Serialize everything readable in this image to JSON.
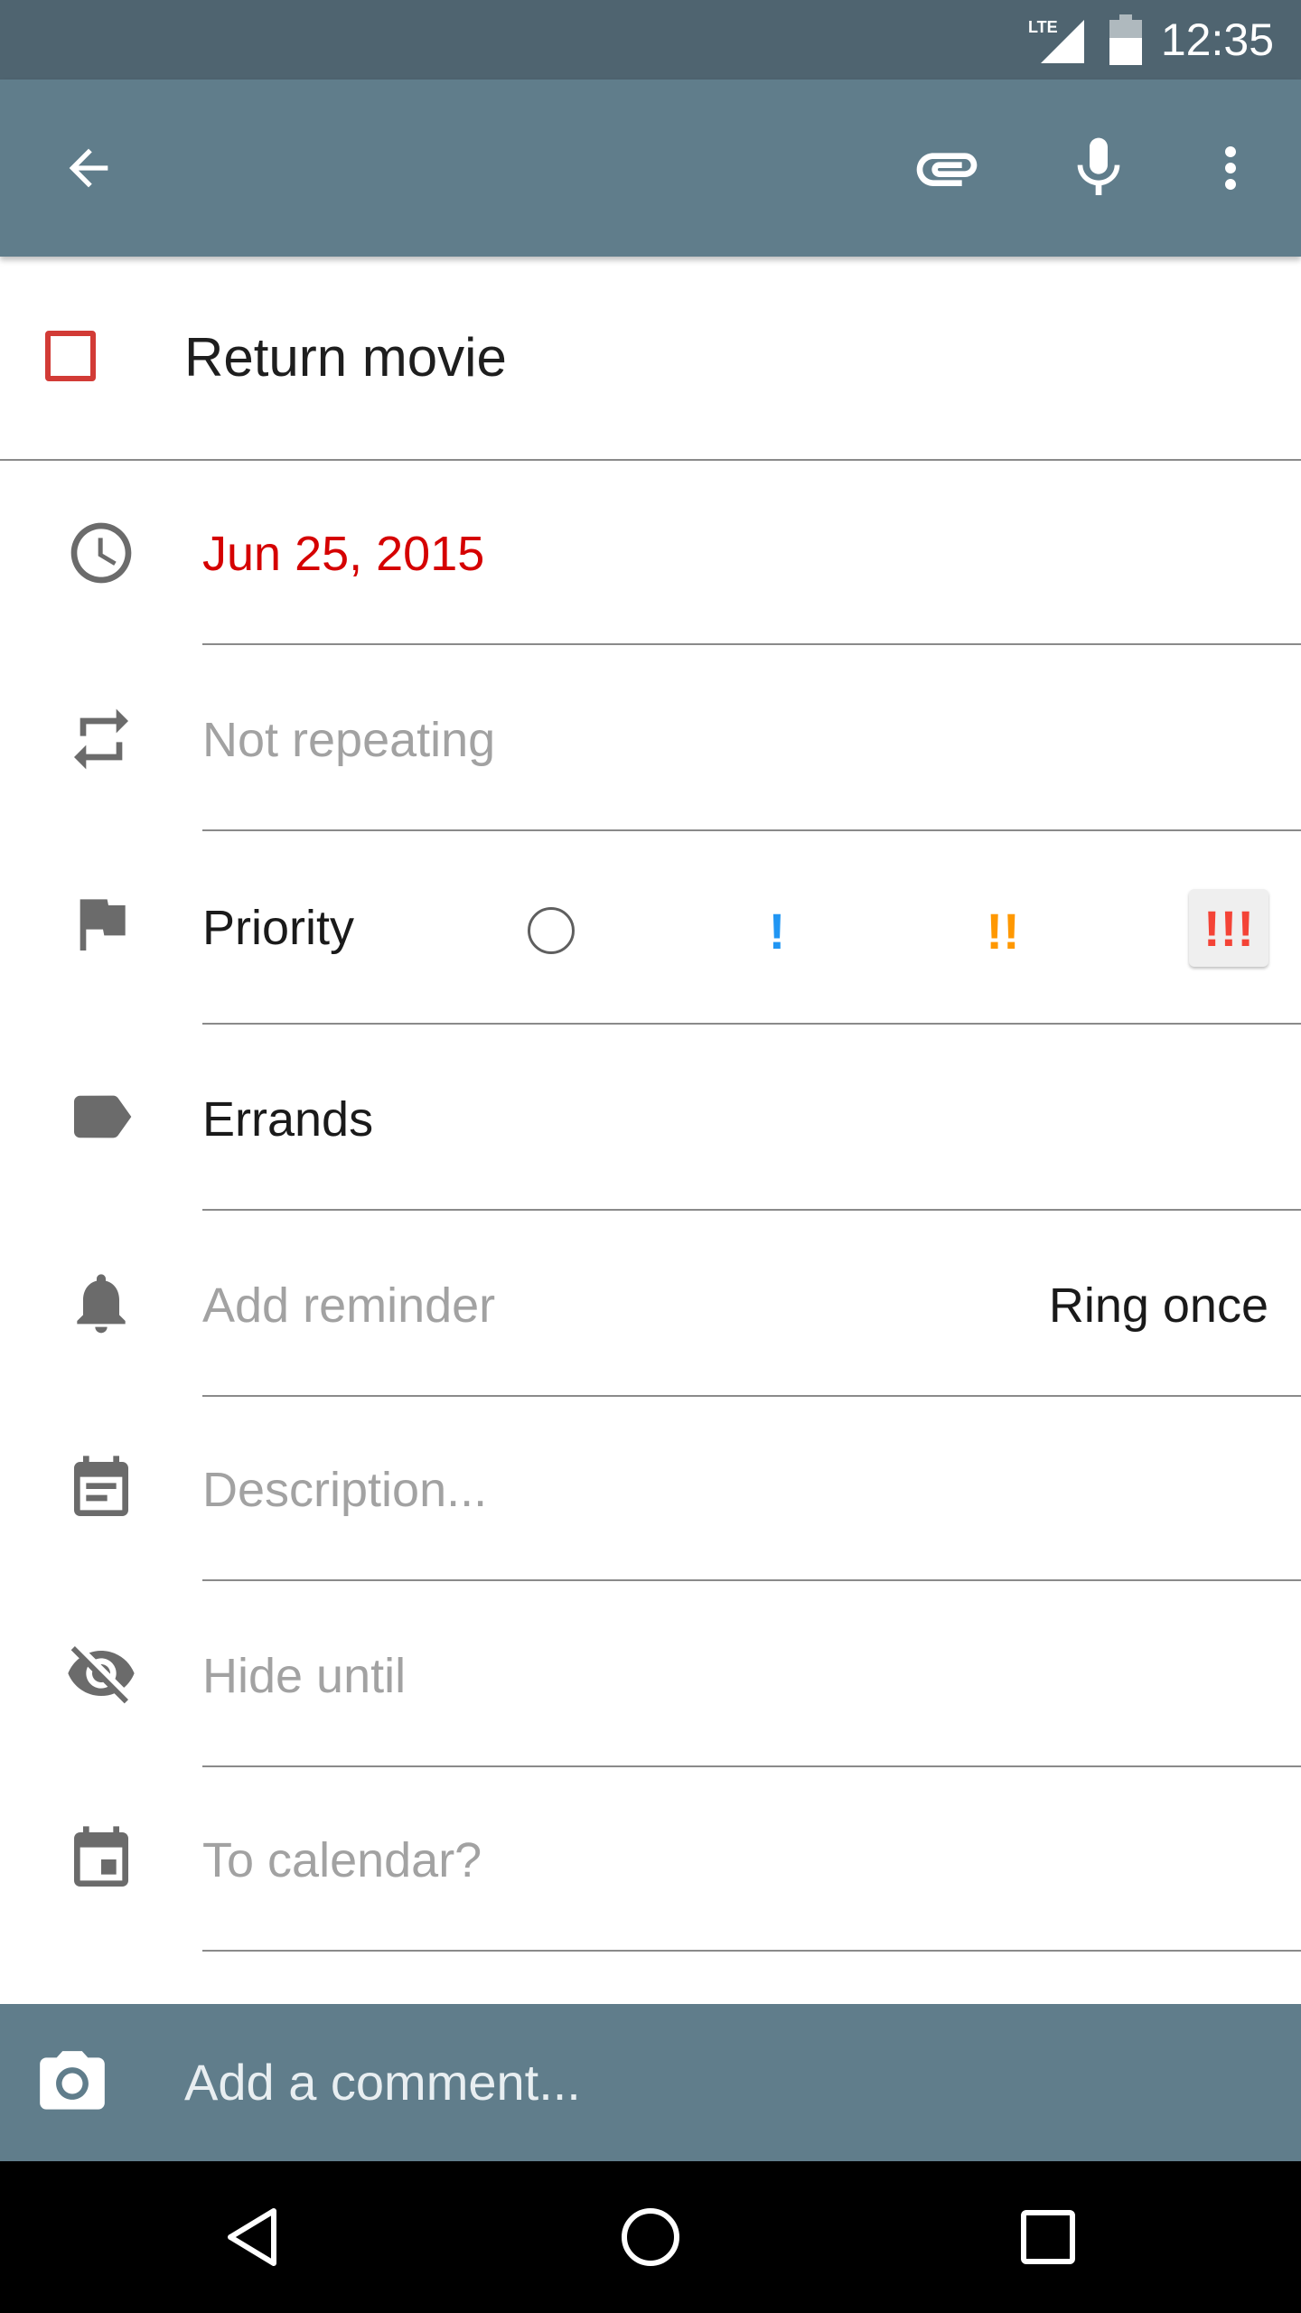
{
  "status_bar": {
    "time": "12:35",
    "network": "LTE"
  },
  "app_bar": {
    "icons": [
      "back-arrow-icon",
      "attach-icon",
      "microphone-icon",
      "more-vert-icon"
    ]
  },
  "task": {
    "title": "Return movie",
    "completed": false
  },
  "rows": {
    "due_date": {
      "value": "Jun 25, 2015",
      "color": "#d50000"
    },
    "repeat": {
      "value": "Not repeating"
    },
    "priority": {
      "label": "Priority",
      "options": [
        {
          "name": "none",
          "text": ""
        },
        {
          "name": "low",
          "text": "!",
          "color": "#2196f3"
        },
        {
          "name": "medium",
          "text": "!!",
          "color": "#ff9800"
        },
        {
          "name": "high",
          "text": "!!!",
          "color": "#f44336"
        }
      ],
      "selected": "high"
    },
    "list": {
      "value": "Errands"
    },
    "reminder": {
      "placeholder": "Add reminder",
      "mode": "Ring once"
    },
    "description": {
      "placeholder": "Description..."
    },
    "hide_until": {
      "placeholder": "Hide until"
    },
    "calendar": {
      "placeholder": "To calendar?"
    }
  },
  "comment_bar": {
    "placeholder": "Add a comment..."
  },
  "colors": {
    "status_bar": "#4f6470",
    "app_bar": "#607d8b",
    "checkbox": "#d23b36"
  }
}
